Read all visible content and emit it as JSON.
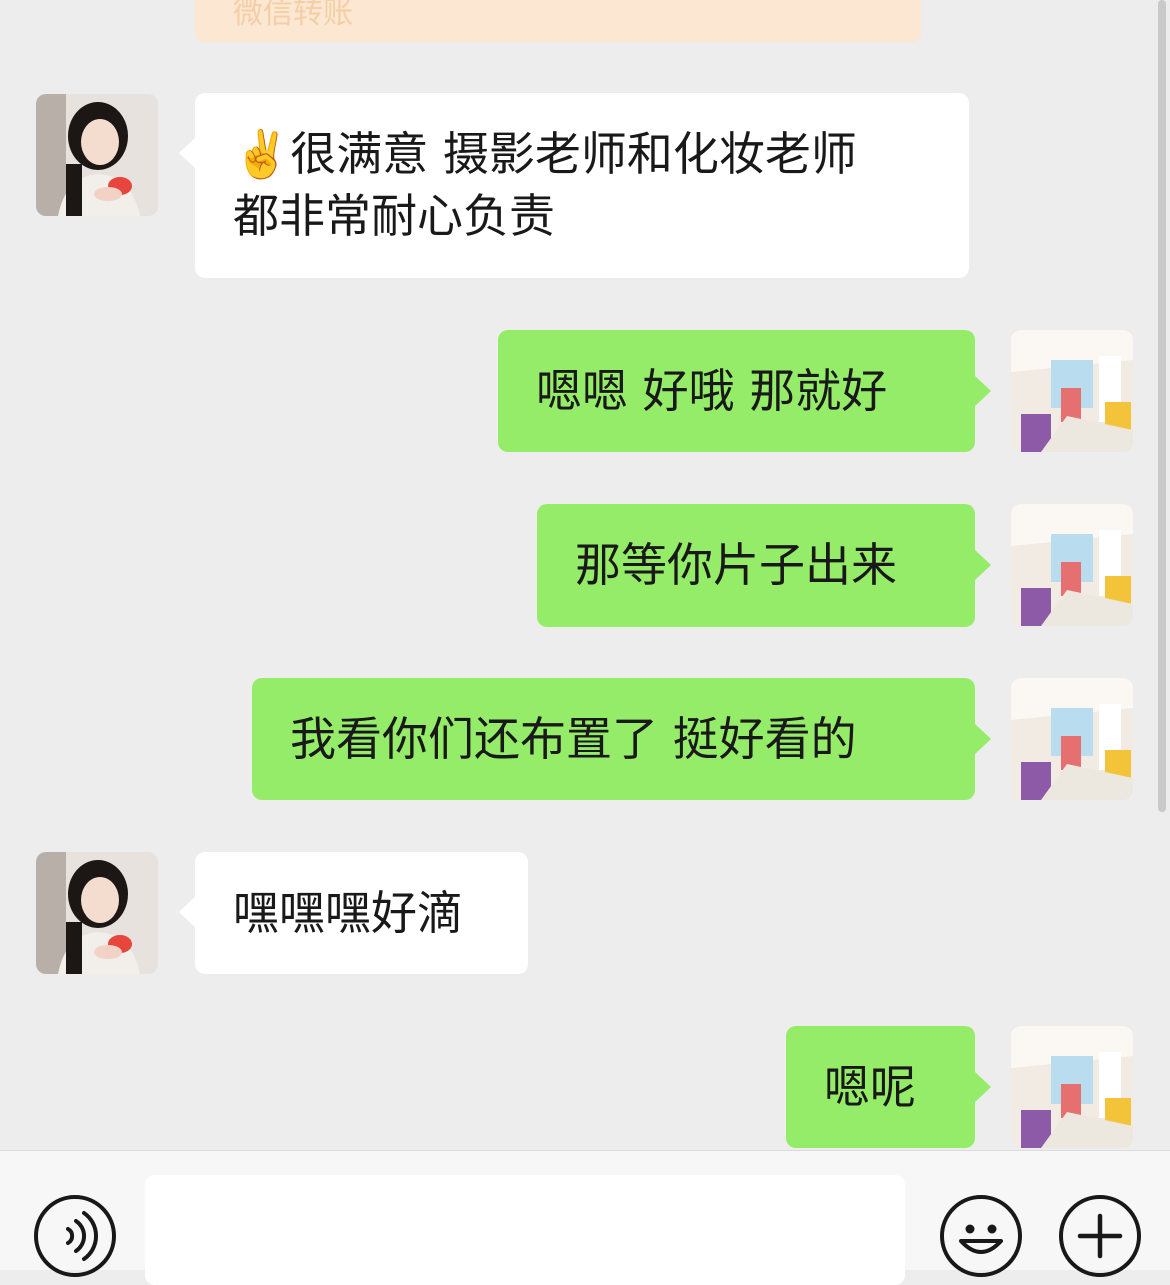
{
  "transfer": {
    "label": "微信转账"
  },
  "messages": [
    {
      "side": "in",
      "lines": [
        "✌️很满意 摄影老师和化妆老师",
        "都非常耐心负责"
      ]
    },
    {
      "side": "out",
      "lines": [
        "嗯嗯 好哦 那就好"
      ]
    },
    {
      "side": "out",
      "lines": [
        "那等你片子出来"
      ]
    },
    {
      "side": "out",
      "lines": [
        "我看你们还布置了 挺好看的"
      ]
    },
    {
      "side": "in",
      "lines": [
        "嘿嘿嘿好滴"
      ]
    },
    {
      "side": "out",
      "lines": [
        "嗯呢"
      ]
    }
  ],
  "input_bar": {
    "voice_icon": "voice-icon",
    "text_value": "",
    "emoji_icon": "emoji-icon",
    "plus_icon": "plus-icon"
  },
  "colors": {
    "background": "#ededed",
    "incoming_bubble": "#ffffff",
    "outgoing_bubble": "#95ec69",
    "transfer_card": "#fbe7d2"
  }
}
